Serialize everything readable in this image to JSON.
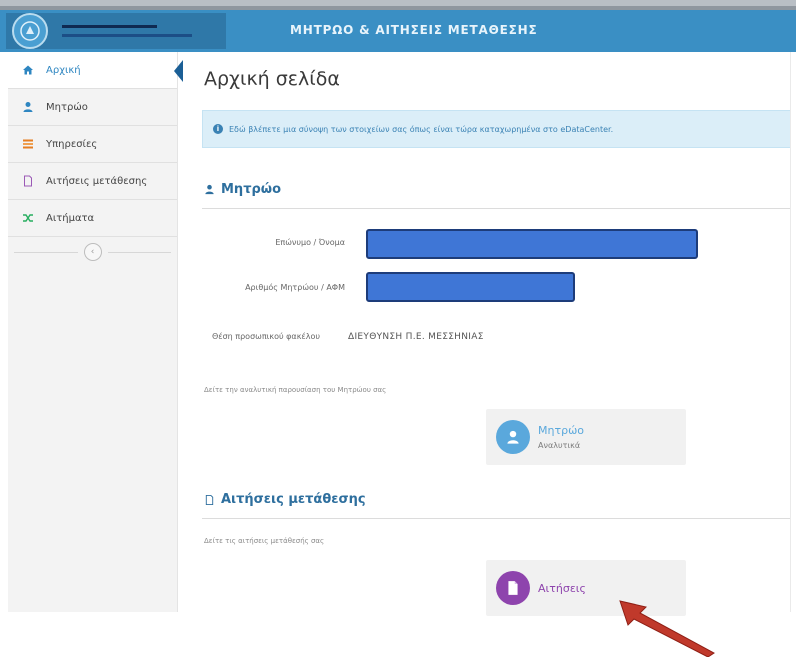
{
  "header": {
    "title": "ΜΗΤΡΩΟ & ΑΙΤΗΣΕΙΣ ΜΕΤΑΘΕΣΗΣ"
  },
  "sidebar": {
    "items": [
      {
        "label": "Αρχική",
        "icon": "home-icon",
        "active": true
      },
      {
        "label": "Μητρώο",
        "icon": "user-icon",
        "active": false
      },
      {
        "label": "Υπηρεσίες",
        "icon": "list-icon",
        "active": false
      },
      {
        "label": "Αιτήσεις μετάθεσης",
        "icon": "document-icon",
        "active": false
      },
      {
        "label": "Αιτήματα",
        "icon": "shuffle-icon",
        "active": false
      }
    ]
  },
  "main": {
    "page_title": "Αρχική σελίδα",
    "info_message": "Εδώ βλέπετε μια σύνοψη των στοιχείων σας όπως είναι τώρα καταχωρημένα στο eDataCenter.",
    "registry_section": {
      "title": "Μητρώο",
      "fields": [
        {
          "label": "Επώνυμο / Όνομα",
          "value": ""
        },
        {
          "label": "Αριθμός Μητρώου / ΑΦΜ",
          "value": ""
        },
        {
          "label": "Θέση προσωπικού φακέλου",
          "value": "ΔΙΕΥΘΥΝΣΗ Π.Ε. ΜΕΣΣΗΝΙΑΣ"
        }
      ],
      "hint": "Δείτε την αναλυτική παρουσίαση του Μητρώου σας",
      "tile": {
        "title": "Μητρώο",
        "subtitle": "Αναλυτικά"
      }
    },
    "transfer_section": {
      "title": "Αιτήσεις μετάθεσης",
      "hint": "Δείτε τις αιτήσεις μετάθεσής σας",
      "tile": {
        "title": "Αιτήσεις"
      }
    }
  },
  "colors": {
    "header": "#3a8fc4",
    "accent": "#2e86c1",
    "registry_tile_icon": "#5aa8dc",
    "transfer_tile_icon": "#8e44ad",
    "redaction": "#3f76d6",
    "annotation_arrow": "#c0392b"
  }
}
